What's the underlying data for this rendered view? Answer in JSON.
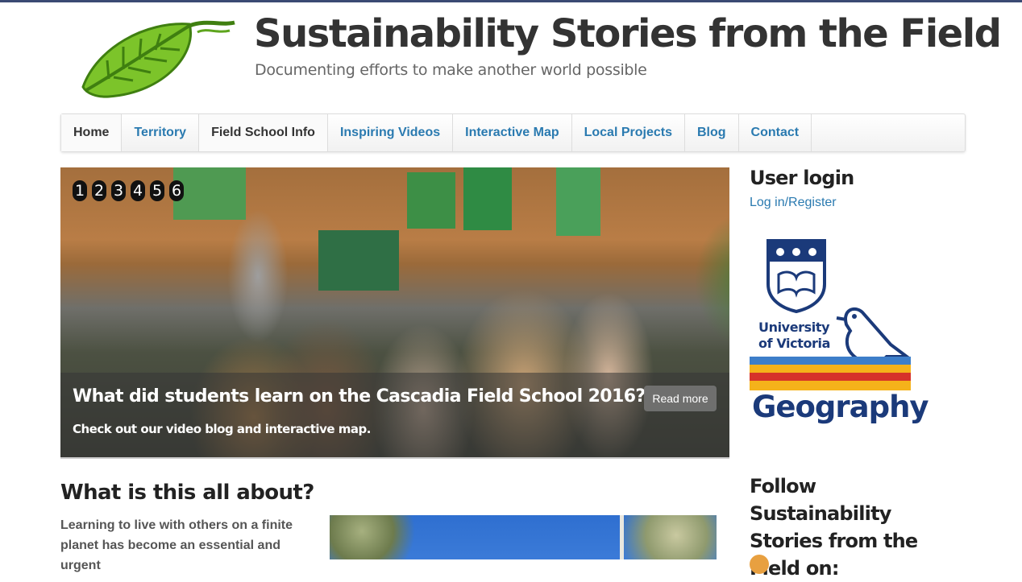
{
  "header": {
    "title": "Sustainability Stories from the Field",
    "slogan": "Documenting efforts to make another world possible",
    "logo_icon": "leaf-logo-icon"
  },
  "nav": {
    "items": [
      {
        "label": "Home"
      },
      {
        "label": "Territory"
      },
      {
        "label": "Field School Info"
      },
      {
        "label": "Inspiring Videos"
      },
      {
        "label": "Interactive Map"
      },
      {
        "label": "Local Projects"
      },
      {
        "label": "Blog"
      },
      {
        "label": "Contact"
      }
    ]
  },
  "slider": {
    "pager": [
      "1",
      "2",
      "3",
      "4",
      "5",
      "6"
    ],
    "caption_title": "What did students learn on the Cascadia Field School 2016?",
    "caption_sub": "Check out our video blog and interactive map.",
    "read_more": "Read more"
  },
  "about": {
    "heading": "What is this all about?",
    "text": "Learning to live with others on a finite planet has become an essential and urgent"
  },
  "sidebar": {
    "login_title": "User login",
    "login_link": "Log in/Register",
    "uvic_line1": "University",
    "uvic_line2": "of Victoria",
    "uvic_dept": "Geography",
    "follow_title": "Follow Sustainability Stories from the Field on:"
  },
  "colors": {
    "link": "#2a7ab0",
    "uvic_blue": "#1b3a7a",
    "uvic_gold": "#f5b21a",
    "uvic_red": "#d6322a",
    "topbar": "#3b4a73"
  }
}
